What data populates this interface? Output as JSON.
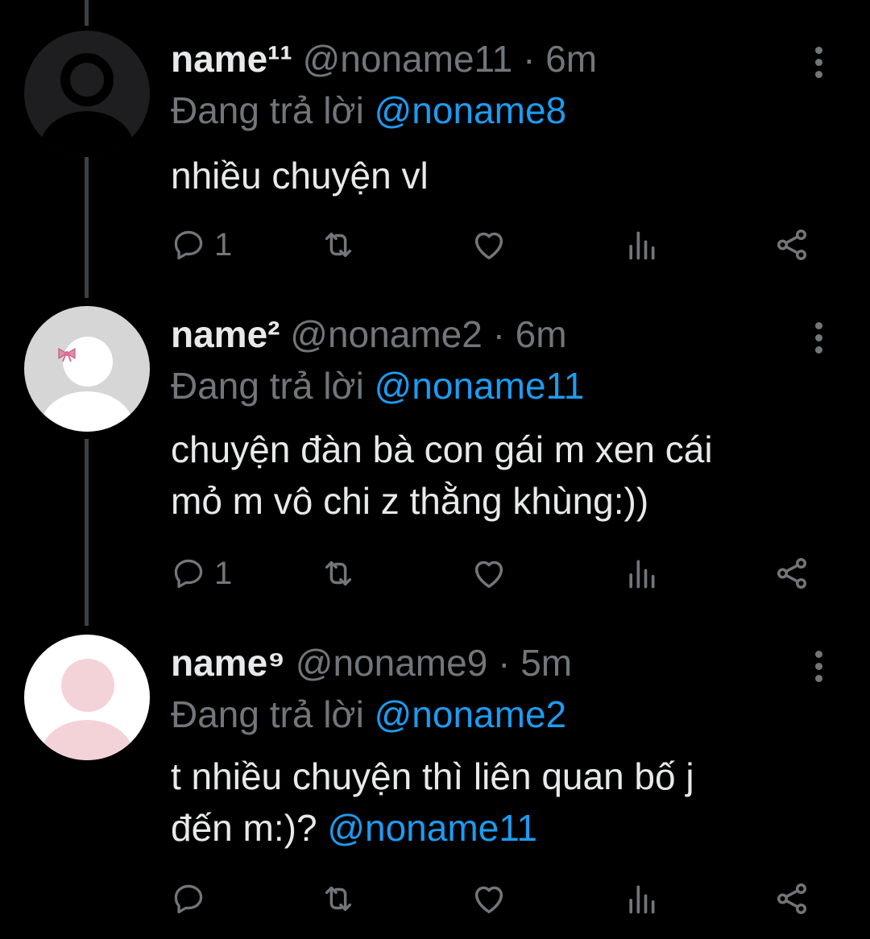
{
  "colors": {
    "background": "#000000",
    "text": "#e7e9ea",
    "muted": "#71767b",
    "link": "#1d9bf0",
    "thread_line": "#3e4144"
  },
  "tweets": [
    {
      "name": "name¹¹",
      "handle": "@noname11",
      "separator": "·",
      "time": "6m",
      "reply_prefix": "Đang trả lời",
      "reply_to": "@noname8",
      "text": "nhiều chuyện vl",
      "reply_count": "1",
      "avatar": "default-avatar-dark"
    },
    {
      "name": "name²",
      "handle": "@noname2",
      "separator": "·",
      "time": "6m",
      "reply_prefix": "Đang trả lời",
      "reply_to": "@noname11",
      "text_lines": [
        "chuyện đàn bà con gái m xen cái",
        "mỏ m vô chi z thằng khùng:))"
      ],
      "reply_count": "1",
      "avatar": "default-avatar-bow"
    },
    {
      "name": "name⁹",
      "handle": "@noname9",
      "separator": "·",
      "time": "5m",
      "reply_prefix": "Đang trả lời",
      "reply_to": "@noname2",
      "text_lines": [
        "t nhiều chuyện thì liên quan bố j",
        "đến m:)?"
      ],
      "mention": "@noname11",
      "reply_count": "",
      "avatar": "default-avatar-pink"
    }
  ],
  "icons": [
    "reply-icon",
    "retweet-icon",
    "like-icon",
    "views-icon",
    "share-icon",
    "more-icon"
  ]
}
